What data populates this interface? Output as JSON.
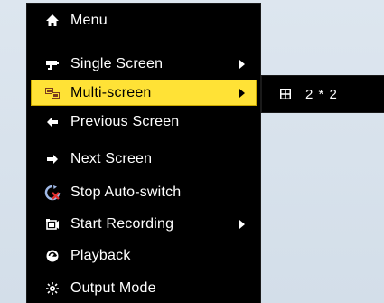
{
  "main_menu": {
    "items": [
      {
        "label": "Menu",
        "icon": "home-icon",
        "has_submenu": false,
        "selected": false
      },
      {
        "label": "Single Screen",
        "icon": "camera-icon",
        "has_submenu": true,
        "selected": false
      },
      {
        "label": "Multi-screen",
        "icon": "multi-screen-icon",
        "has_submenu": true,
        "selected": true
      },
      {
        "label": "Previous Screen",
        "icon": "arrow-left-icon",
        "has_submenu": false,
        "selected": false
      },
      {
        "label": "Next Screen",
        "icon": "arrow-right-icon",
        "has_submenu": false,
        "selected": false
      },
      {
        "label": "Stop Auto-switch",
        "icon": "stop-auto-switch-icon",
        "has_submenu": false,
        "selected": false
      },
      {
        "label": "Start Recording",
        "icon": "record-icon",
        "has_submenu": true,
        "selected": false
      },
      {
        "label": "Playback",
        "icon": "playback-icon",
        "has_submenu": false,
        "selected": false
      },
      {
        "label": "Output Mode",
        "icon": "output-mode-icon",
        "has_submenu": false,
        "selected": false
      }
    ],
    "selected_color": "#ffe236",
    "background_color": "#000000"
  },
  "submenu": {
    "items": [
      {
        "label": "2 * 2",
        "icon": "grid-2x2-icon"
      }
    ]
  }
}
